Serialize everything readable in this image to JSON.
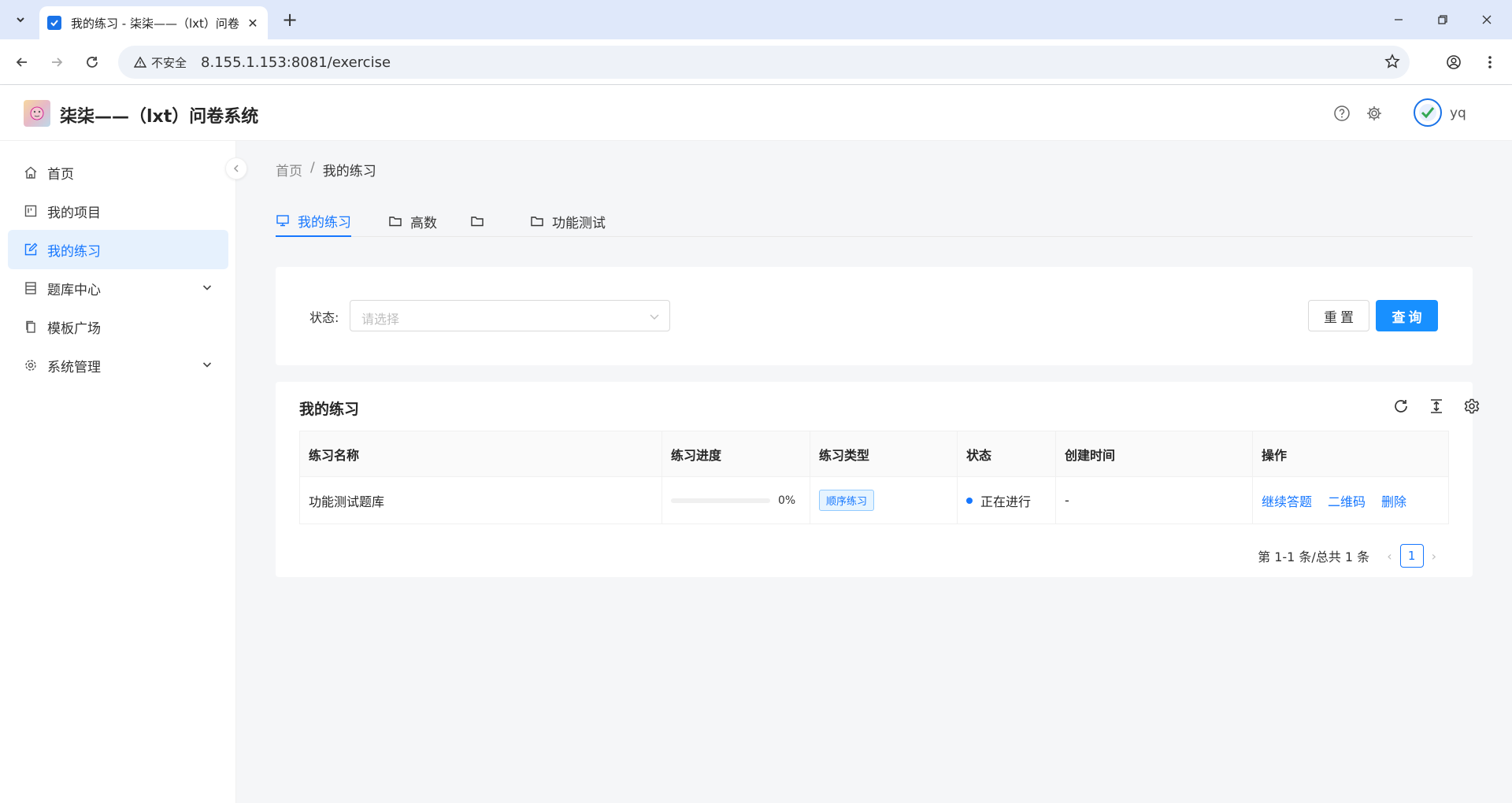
{
  "browser": {
    "tab_title": "我的练习 - 柒柒——（lxt）问卷",
    "security_label": "不安全",
    "url": "8.155.1.153:8081/exercise"
  },
  "header": {
    "title": "柒柒——（lxt）问卷系统",
    "username": "yq"
  },
  "sidebar": {
    "items": [
      {
        "label": "首页",
        "icon": "home-icon"
      },
      {
        "label": "我的项目",
        "icon": "project-icon"
      },
      {
        "label": "我的练习",
        "icon": "edit-icon",
        "active": true
      },
      {
        "label": "题库中心",
        "icon": "database-icon",
        "expandable": true
      },
      {
        "label": "模板广场",
        "icon": "copy-icon"
      },
      {
        "label": "系统管理",
        "icon": "gear-icon",
        "expandable": true
      }
    ]
  },
  "breadcrumb": {
    "home": "首页",
    "separator": "/",
    "current": "我的练习"
  },
  "tabs": [
    {
      "label": "我的练习",
      "icon": "desktop-icon",
      "active": true
    },
    {
      "label": "高数",
      "icon": "folder-icon"
    },
    {
      "label": "",
      "icon": "folder-icon"
    },
    {
      "label": "功能测试",
      "icon": "folder-icon"
    }
  ],
  "filter": {
    "status_label": "状态:",
    "status_placeholder": "请选择",
    "reset_label": "重置",
    "search_label": "查询"
  },
  "table": {
    "title": "我的练习",
    "columns": [
      "练习名称",
      "练习进度",
      "练习类型",
      "状态",
      "创建时间",
      "操作"
    ],
    "rows": [
      {
        "name": "功能测试题库",
        "progress": 0,
        "progress_text": "0%",
        "type": "顺序练习",
        "status": "正在进行",
        "created": "-",
        "actions": [
          "继续答题",
          "二维码",
          "删除"
        ]
      }
    ]
  },
  "pagination": {
    "summary": "第 1-1 条/总共 1 条",
    "current_page": "1"
  },
  "colors": {
    "primary": "#1677ff",
    "button": "#1890ff",
    "active_bg": "#e6f1fd"
  }
}
